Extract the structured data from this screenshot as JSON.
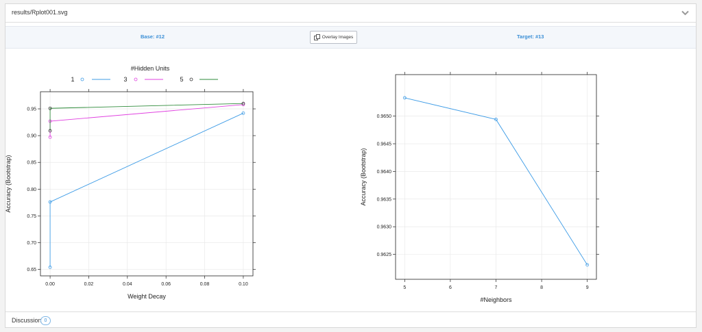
{
  "file": {
    "name": "results/Rplot001.svg"
  },
  "compare": {
    "base_label": "Base: #12",
    "target_label": "Target: #13",
    "overlay_label": "Overlay Images"
  },
  "discussion": {
    "label": "Discussion",
    "count": "0"
  },
  "colors": {
    "series1": "#3c9be6",
    "series3": "#e040e0",
    "series5": "#2e8b3a",
    "link": "#3b8fd6"
  },
  "chart_data": [
    {
      "type": "line",
      "title": "",
      "legend_title": "#Hidden Units",
      "legend_placement": "top",
      "xlabel": "Weight Decay",
      "ylabel": "Accuracy (Bootstrap)",
      "xlim": [
        -0.005,
        0.105
      ],
      "ylim": [
        0.638,
        0.982
      ],
      "x_ticks": [
        "0.00",
        "0.02",
        "0.04",
        "0.06",
        "0.08",
        "0.10"
      ],
      "y_ticks": [
        "0.65",
        "0.70",
        "0.75",
        "0.80",
        "0.85",
        "0.90",
        "0.95"
      ],
      "grid": true,
      "series": [
        {
          "name": "1",
          "color": "#3c9be6",
          "x": [
            0.0,
            0.0,
            0.1
          ],
          "y": [
            0.654,
            0.776,
            0.942
          ]
        },
        {
          "name": "3",
          "color": "#e040e0",
          "x": [
            0.0,
            0.0,
            0.1
          ],
          "y": [
            0.897,
            0.927,
            0.958
          ]
        },
        {
          "name": "5",
          "color": "#2e8b3a",
          "x": [
            0.0,
            0.0,
            0.1
          ],
          "y": [
            0.909,
            0.951,
            0.96
          ]
        }
      ]
    },
    {
      "type": "line",
      "title": "",
      "xlabel": "#Neighbors",
      "ylabel": "Accuracy (Bootstrap)",
      "xlim": [
        4.8,
        9.2
      ],
      "ylim": [
        0.96205,
        0.96575
      ],
      "x_ticks": [
        "5",
        "6",
        "7",
        "8",
        "9"
      ],
      "y_ticks": [
        "0.9625",
        "0.9630",
        "0.9635",
        "0.9640",
        "0.9645",
        "0.9650"
      ],
      "grid": true,
      "series": [
        {
          "color": "#3c9be6",
          "x": [
            5,
            7,
            9
          ],
          "y": [
            0.96533,
            0.96494,
            0.96231
          ]
        }
      ]
    }
  ]
}
